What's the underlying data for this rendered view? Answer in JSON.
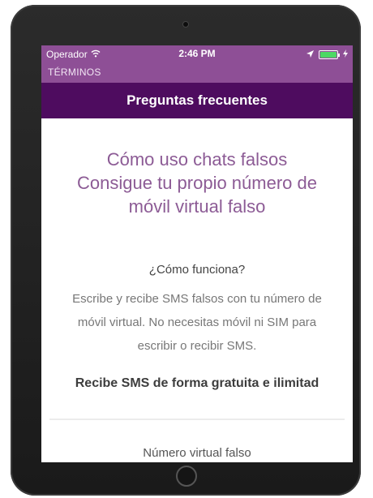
{
  "statusbar": {
    "carrier": "Operador",
    "time": "2:46 PM",
    "icons": [
      "wifi-icon",
      "location-arrow-icon",
      "battery-icon",
      "charging-icon"
    ],
    "battery_color": "#4cd964"
  },
  "navbar": {
    "back_label": "TÉRMINOS"
  },
  "titlebar": {
    "title": "Preguntas frecuentes"
  },
  "main": {
    "heading_lines": [
      "Cómo uso chats falsos",
      "Consigue tu propio número de",
      "móvil virtual falso"
    ],
    "subheading": "¿Cómo funciona?",
    "description_lines": [
      "Escribe y recibe SMS falsos con tu número de",
      "móvil virtual. No necesitas móvil ni SIM para",
      "escribir o recibir SMS."
    ],
    "highlight": "Recibe SMS de forma gratuita e ilimitad",
    "next_title": "Número virtual falso"
  },
  "colors": {
    "navbar": "#8e4f96",
    "titlebar": "#4e0c5f",
    "heading": "#8c5b95"
  }
}
